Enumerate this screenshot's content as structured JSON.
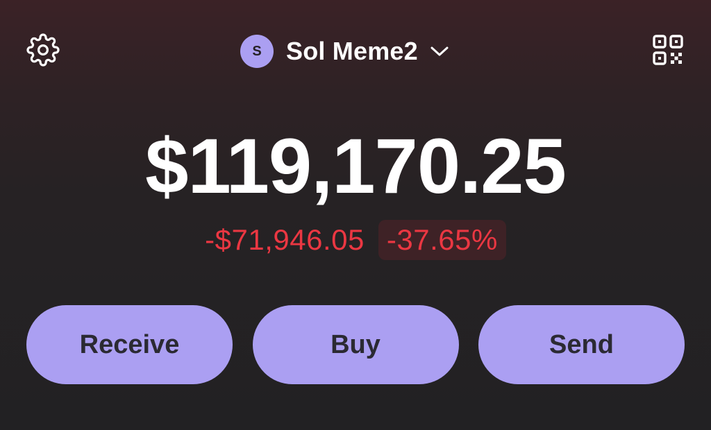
{
  "header": {
    "settings_icon": "gear-icon",
    "account": {
      "avatar_initial": "S",
      "name": "Sol Meme2",
      "dropdown_icon": "chevron-down-icon"
    },
    "qr_icon": "qr-code-icon"
  },
  "portfolio": {
    "balance": "$119,170.25",
    "change_value": "-$71,946.05",
    "change_percent": "-37.65%"
  },
  "actions": {
    "receive_label": "Receive",
    "buy_label": "Buy",
    "send_label": "Send"
  },
  "colors": {
    "accent": "#ab9ff2",
    "negative": "#eb3742",
    "background": "#222123"
  }
}
